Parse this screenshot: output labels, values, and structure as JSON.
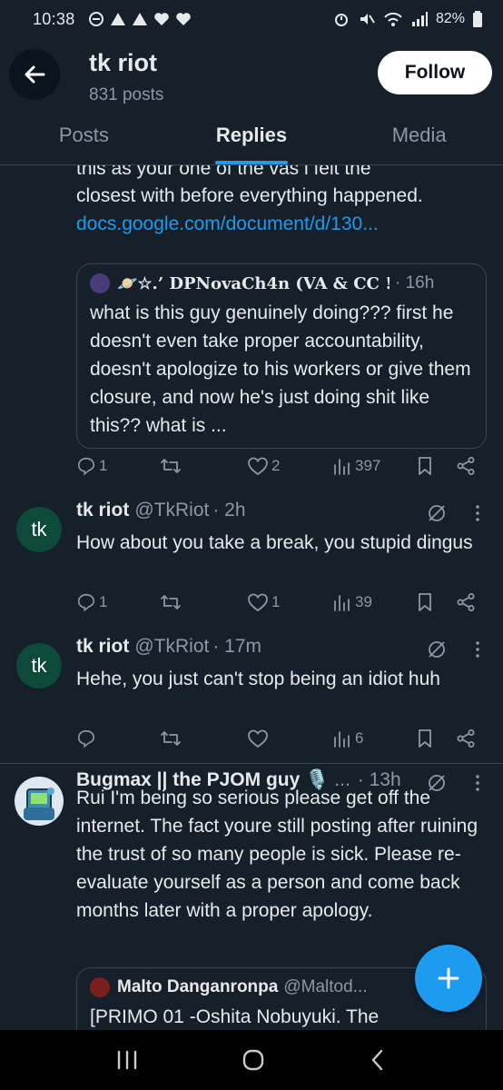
{
  "status_bar": {
    "time": "10:38",
    "battery": "82%"
  },
  "header": {
    "name": "tk riot",
    "post_count": "831 posts",
    "follow_label": "Follow"
  },
  "tabs": [
    {
      "label": "Posts",
      "active": false
    },
    {
      "label": "Replies",
      "active": true
    },
    {
      "label": "Media",
      "active": false
    }
  ],
  "post1": {
    "text_partial": "this as your one of the vas i felt the",
    "text_line2": "closest with before everything happened.",
    "link": "docs.google.com/document/d/130...",
    "quote": {
      "author": "🪐☆.’ DPNovaCh4n (VA & CC !...",
      "time": "· 16h",
      "text": "what is this guy genuinely doing??? first he doesn't even take proper accountability, doesn't apologize to his workers or give them closure, and now he's just doing shit like this?? what is ..."
    },
    "replies": "1",
    "reposts": "",
    "likes": "2",
    "views": "397"
  },
  "post2": {
    "avatar_text": "tk",
    "name": "tk riot",
    "handle": "@TkRiot",
    "time": "· 2h",
    "text": "How about you take a break, you stupid dingus",
    "replies": "1",
    "likes": "1",
    "views": "39"
  },
  "post3": {
    "avatar_text": "tk",
    "name": "tk riot",
    "handle": "@TkRiot",
    "time": "· 17m",
    "text": "Hehe, you just can't stop being an idiot huh",
    "replies": "",
    "likes": "",
    "views": "6"
  },
  "post4": {
    "name": "Bugmax || the PJOM guy 🎙️",
    "more": "...",
    "time": "· 13h",
    "text": "Rui I'm being so serious please get off the internet. The fact youre still posting after ruining the trust of so many people is sick. Please re-evaluate yourself as a person and come back months later with a proper apology.",
    "quote": {
      "author": "Malto Danganronpa",
      "handle": "@Maltod...",
      "text": "[PRIMO 01 -Oshita Nobuyuki. The"
    }
  },
  "colors": {
    "background": "#15202b",
    "accent": "#1d9bf0",
    "muted": "#8b98a5",
    "text": "#e7e9ea",
    "divider": "#38444d"
  },
  "icons": [
    "back-arrow-icon",
    "reply-icon",
    "repost-icon",
    "like-icon",
    "views-icon",
    "bookmark-icon",
    "share-icon",
    "grok-icon",
    "more-icon",
    "compose-icon",
    "recents-icon",
    "home-icon",
    "back-nav-icon"
  ]
}
